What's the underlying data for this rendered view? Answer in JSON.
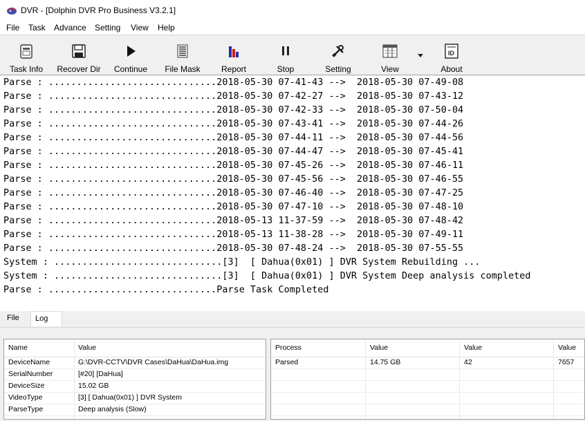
{
  "window": {
    "title": "DVR - [Dolphin DVR Pro Business V3.2.1]",
    "icon": "dolphin-app-icon"
  },
  "menu": [
    "File",
    "Task",
    "Advance",
    "Setting",
    "View",
    "Help"
  ],
  "toolbar": [
    {
      "label": "Task Info",
      "icon": "task-info-icon"
    },
    {
      "label": "Recover Dir",
      "icon": "floppy-disk-icon"
    },
    {
      "label": "Continue",
      "icon": "play-icon"
    },
    {
      "label": "File Mask",
      "icon": "list-icon"
    },
    {
      "label": "Report",
      "icon": "bar-chart-icon"
    },
    {
      "label": "Stop",
      "icon": "pause-icon"
    },
    {
      "label": "Setting",
      "icon": "tools-icon"
    },
    {
      "label": "View",
      "icon": "view-icon"
    },
    {
      "label": "About",
      "icon": "id-card-icon"
    }
  ],
  "log_lines": [
    "Parse : ..............................2018-05-30 07-41-43 -->  2018-05-30 07-49-08",
    "Parse : ..............................2018-05-30 07-42-27 -->  2018-05-30 07-43-12",
    "Parse : ..............................2018-05-30 07-42-33 -->  2018-05-30 07-50-04",
    "Parse : ..............................2018-05-30 07-43-41 -->  2018-05-30 07-44-26",
    "Parse : ..............................2018-05-30 07-44-11 -->  2018-05-30 07-44-56",
    "Parse : ..............................2018-05-30 07-44-47 -->  2018-05-30 07-45-41",
    "Parse : ..............................2018-05-30 07-45-26 -->  2018-05-30 07-46-11",
    "Parse : ..............................2018-05-30 07-45-56 -->  2018-05-30 07-46-55",
    "Parse : ..............................2018-05-30 07-46-40 -->  2018-05-30 07-47-25",
    "Parse : ..............................2018-05-30 07-47-10 -->  2018-05-30 07-48-10",
    "Parse : ..............................2018-05-13 11-37-59 -->  2018-05-30 07-48-42",
    "Parse : ..............................2018-05-13 11-38-28 -->  2018-05-30 07-49-11",
    "Parse : ..............................2018-05-30 07-48-24 -->  2018-05-30 07-55-55",
    "System : ..............................[3]  [ Dahua(0x01) ] DVR System Rebuilding ...",
    "System : ..............................[3]  [ Dahua(0x01) ] DVR System Deep analysis completed",
    "Parse : ..............................Parse Task Completed"
  ],
  "tabs": [
    "File",
    "Log"
  ],
  "info_table": {
    "headers": [
      "Name",
      "Value"
    ],
    "rows": [
      [
        "DeviceName",
        "G:\\DVR-CCTV\\DVR Cases\\DaHua\\DaHua.img"
      ],
      [
        "SerialNumber",
        "[#20] [DaHua]"
      ],
      [
        "DeviceSize",
        "15.02 GB"
      ],
      [
        "VideoType",
        "[3]  [ Dahua(0x01) ] DVR System"
      ],
      [
        "ParseType",
        "Deep analysis (Slow)"
      ]
    ]
  },
  "process_table": {
    "headers": [
      "Process",
      "Value",
      "Value",
      "Value"
    ],
    "rows": [
      [
        "Parsed",
        "14.75 GB",
        "42",
        "7657"
      ]
    ]
  }
}
